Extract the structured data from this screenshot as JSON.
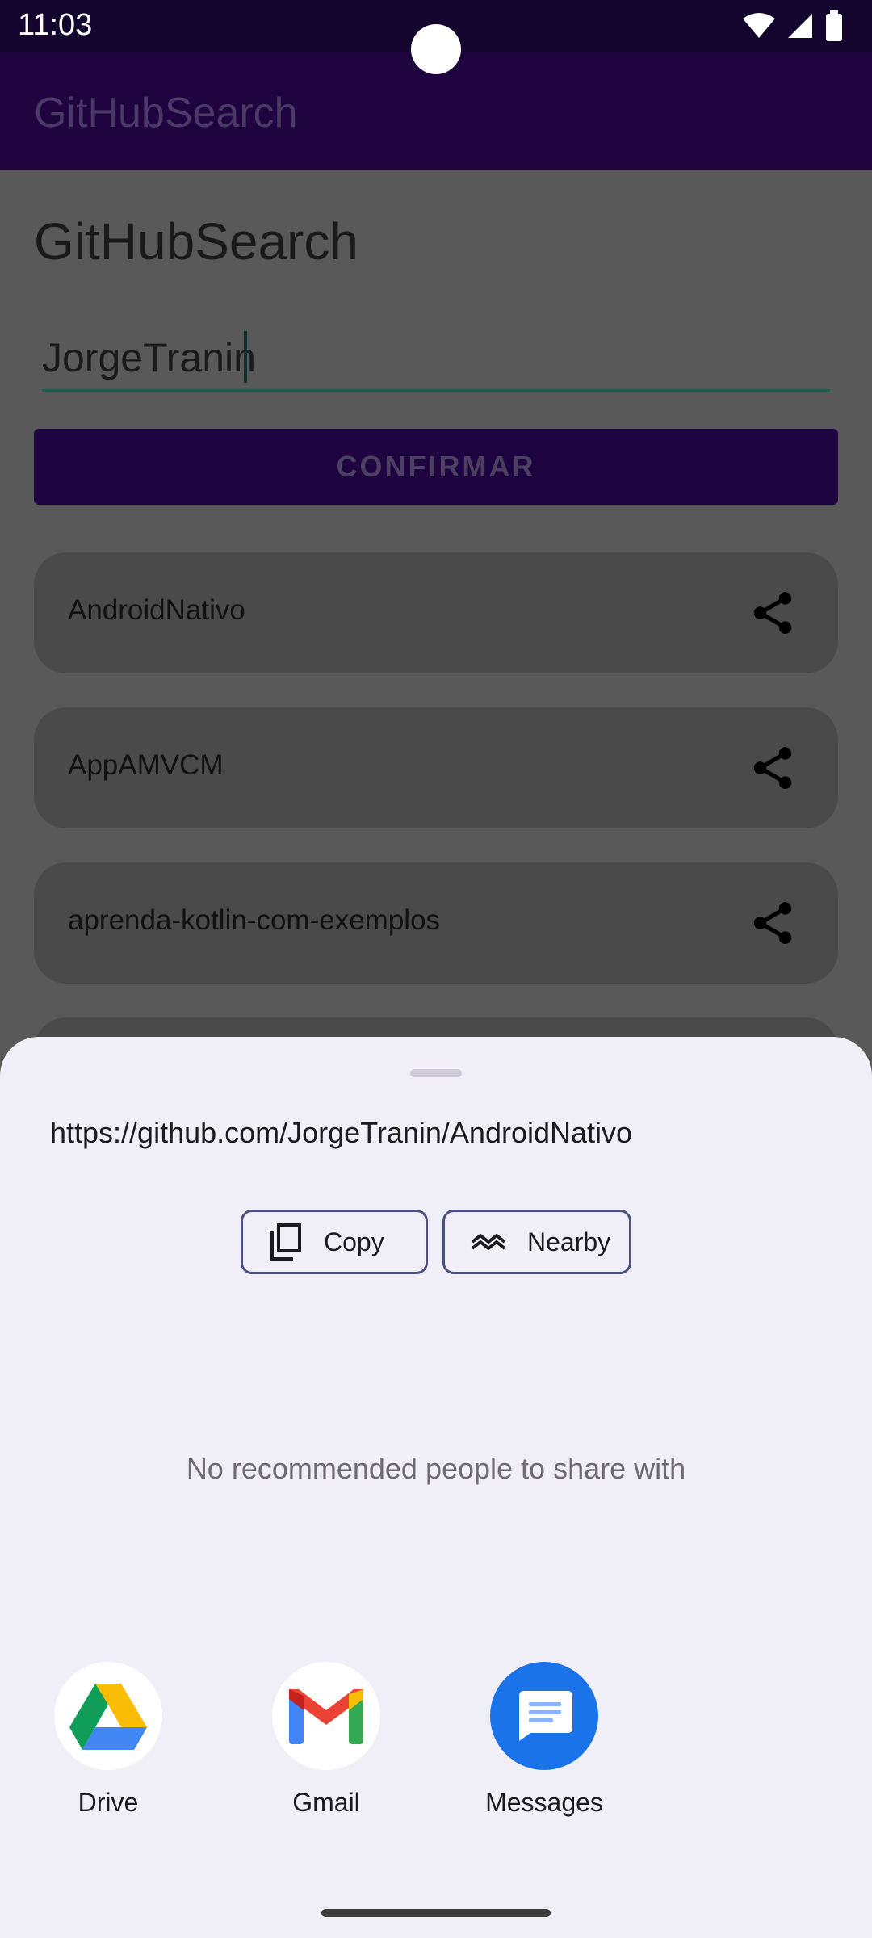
{
  "status_bar": {
    "time": "11:03",
    "icons": [
      "wifi-icon",
      "signal-icon",
      "battery-icon"
    ]
  },
  "app_bar": {
    "title": "GitHubSearch"
  },
  "main": {
    "heading": "GitHubSearch",
    "search_value": "JorgeTranin",
    "confirm_label": "CONFIRMAR",
    "repos": [
      {
        "name": "AndroidNativo"
      },
      {
        "name": "AppAMVCM"
      },
      {
        "name": "aprenda-kotlin-com-exemplos"
      }
    ]
  },
  "share_sheet": {
    "url": "https://github.com/JorgeTranin/AndroidNativo",
    "copy_label": "Copy",
    "nearby_label": "Nearby",
    "empty_text": "No recommended people to share with",
    "apps": [
      {
        "label": "Drive"
      },
      {
        "label": "Gmail"
      },
      {
        "label": "Messages"
      }
    ]
  },
  "colors": {
    "accent": "#1f0440",
    "sheet_bg": "#f0eef6",
    "messages_blue": "#1a73e8"
  }
}
